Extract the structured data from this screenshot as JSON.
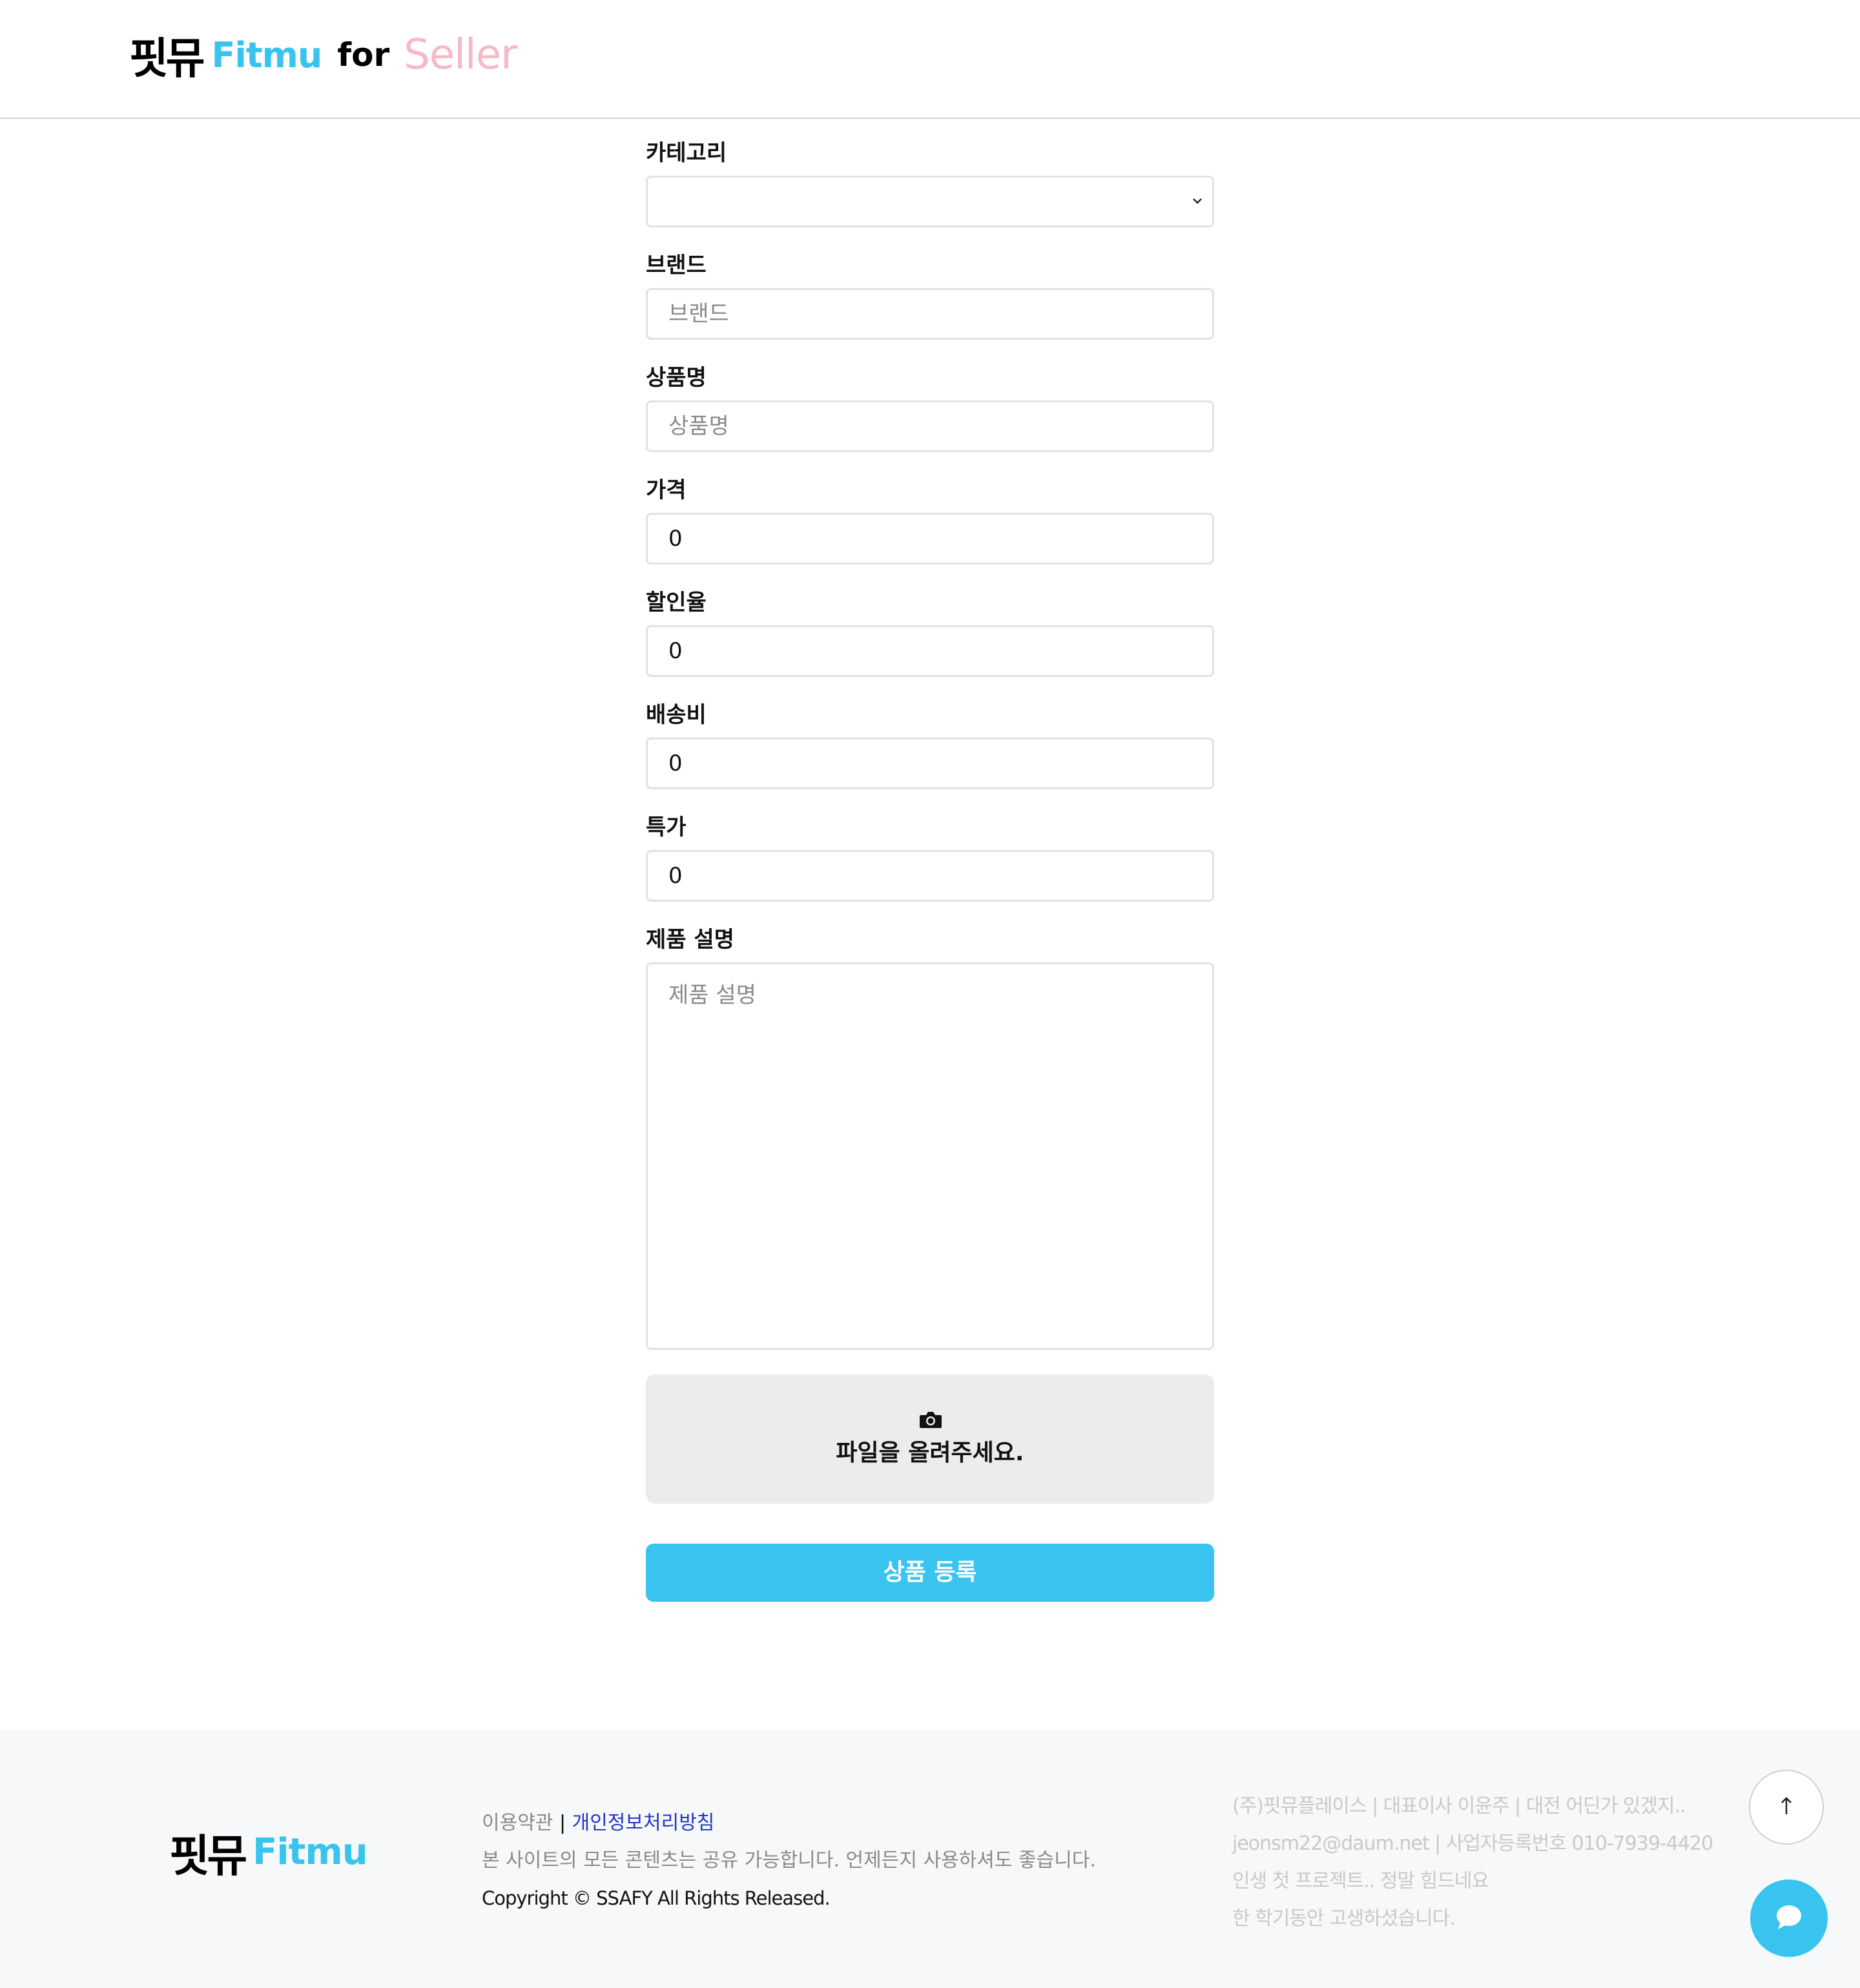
{
  "header": {
    "logo_korean": "핏뮤",
    "logo_english": "Fitmu",
    "logo_for": "for",
    "logo_seller": "Seller"
  },
  "form": {
    "category": {
      "label": "카테고리",
      "value": "",
      "icon": "chevron-down-icon"
    },
    "brand": {
      "label": "브랜드",
      "placeholder": "브랜드"
    },
    "product_name": {
      "label": "상품명",
      "placeholder": "상품명"
    },
    "price": {
      "label": "가격",
      "value": "0"
    },
    "discount_rate": {
      "label": "할인율",
      "value": "0"
    },
    "shipping_fee": {
      "label": "배송비",
      "value": "0"
    },
    "special_price": {
      "label": "특가",
      "value": "0"
    },
    "description": {
      "label": "제품 설명",
      "placeholder": "제품 설명"
    },
    "upload": {
      "icon": "camera-icon",
      "text": "파일을 올려주세요."
    },
    "submit_label": "상품 등록"
  },
  "footer": {
    "logo_korean": "핏뮤",
    "logo_english": "Fitmu",
    "terms_link": "이용약관",
    "separator": "|",
    "privacy_link": "개인정보처리방침",
    "share_notice": "본 사이트의 모든 콘텐츠는 공유 가능합니다. 언제든지 사용하셔도 좋습니다.",
    "copyright": "Copyright © SSAFY All Rights Released.",
    "company_lines": [
      "(주)핏뮤플레이스 | 대표이사 이윤주 | 대전 어딘가 있겠지..",
      "jeonsm22@daum.net | 사업자등록번호 010-7939-4420",
      "인생 첫 프로젝트.. 정말 힘드네요",
      "한 학기동안 고생하셨습니다."
    ]
  },
  "floating": {
    "top_icon": "arrow-up-icon",
    "chat_icon": "chat-bubble-icon"
  },
  "colors": {
    "brand_blue": "#38c4ee",
    "seller_pink": "#f6b9c8",
    "privacy_link": "#1f37c9"
  }
}
